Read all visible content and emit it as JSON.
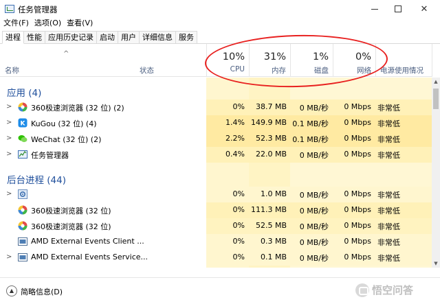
{
  "window": {
    "title": "任务管理器",
    "controls": [
      "minimize",
      "maximize",
      "close"
    ]
  },
  "menu": [
    "文件(F)",
    "选项(O)",
    "查看(V)"
  ],
  "tabs": [
    "进程",
    "性能",
    "应用历史记录",
    "启动",
    "用户",
    "详细信息",
    "服务"
  ],
  "header": {
    "name_label": "名称",
    "status_label": "状态",
    "cpu_pct": "10%",
    "cpu_label": "CPU",
    "mem_pct": "31%",
    "mem_label": "内存",
    "disk_pct": "1%",
    "disk_label": "磁盘",
    "net_pct": "0%",
    "net_label": "网络",
    "power_label": "电源使用情况"
  },
  "groups": {
    "apps": "应用 (4)",
    "background": "后台进程 (44)"
  },
  "rows": [
    {
      "name": "360极速浏览器 (32 位) (2)",
      "icon": "360-browser-icon",
      "cpu": "0%",
      "mem": "38.7 MB",
      "disk": "0 MB/秒",
      "net": "0 Mbps",
      "power": "非常低",
      "expand": true
    },
    {
      "name": "KuGou (32 位) (4)",
      "icon": "kugou-icon",
      "cpu": "1.4%",
      "mem": "149.9 MB",
      "disk": "0.1 MB/秒",
      "net": "0 Mbps",
      "power": "非常低",
      "expand": true
    },
    {
      "name": "WeChat (32 位) (2)",
      "icon": "wechat-icon",
      "cpu": "2.2%",
      "mem": "52.3 MB",
      "disk": "0.1 MB/秒",
      "net": "0 Mbps",
      "power": "非常低",
      "expand": true
    },
    {
      "name": "任务管理器",
      "icon": "task-manager-icon",
      "cpu": "0.4%",
      "mem": "22.0 MB",
      "disk": "0 MB/秒",
      "net": "0 Mbps",
      "power": "非常低",
      "expand": true
    },
    {
      "name": "",
      "icon": "gear-icon",
      "cpu": "0%",
      "mem": "1.0 MB",
      "disk": "0 MB/秒",
      "net": "0 Mbps",
      "power": "非常低",
      "expand": true
    },
    {
      "name": "360极速浏览器 (32 位)",
      "icon": "360-browser-icon",
      "cpu": "0%",
      "mem": "111.3 MB",
      "disk": "0 MB/秒",
      "net": "0 Mbps",
      "power": "非常低",
      "expand": false
    },
    {
      "name": "360极速浏览器 (32 位)",
      "icon": "360-browser-icon",
      "cpu": "0%",
      "mem": "52.5 MB",
      "disk": "0 MB/秒",
      "net": "0 Mbps",
      "power": "非常低",
      "expand": false
    },
    {
      "name": "AMD External Events Client ...",
      "icon": "service-icon",
      "cpu": "0%",
      "mem": "0.3 MB",
      "disk": "0 MB/秒",
      "net": "0 Mbps",
      "power": "非常低",
      "expand": false
    },
    {
      "name": "AMD External Events Service...",
      "icon": "service-icon",
      "cpu": "0%",
      "mem": "0.1 MB",
      "disk": "0 MB/秒",
      "net": "0 Mbps",
      "power": "非常低",
      "expand": true
    }
  ],
  "footer": {
    "toggle_label": "简略信息(D)"
  },
  "watermark": {
    "text": "悟空问答"
  },
  "colors": {
    "group_title": "#1e4e9b",
    "heat_light": "#fff7d4",
    "heat_medium": "#fff1b8",
    "annotation": "#e8201f"
  }
}
